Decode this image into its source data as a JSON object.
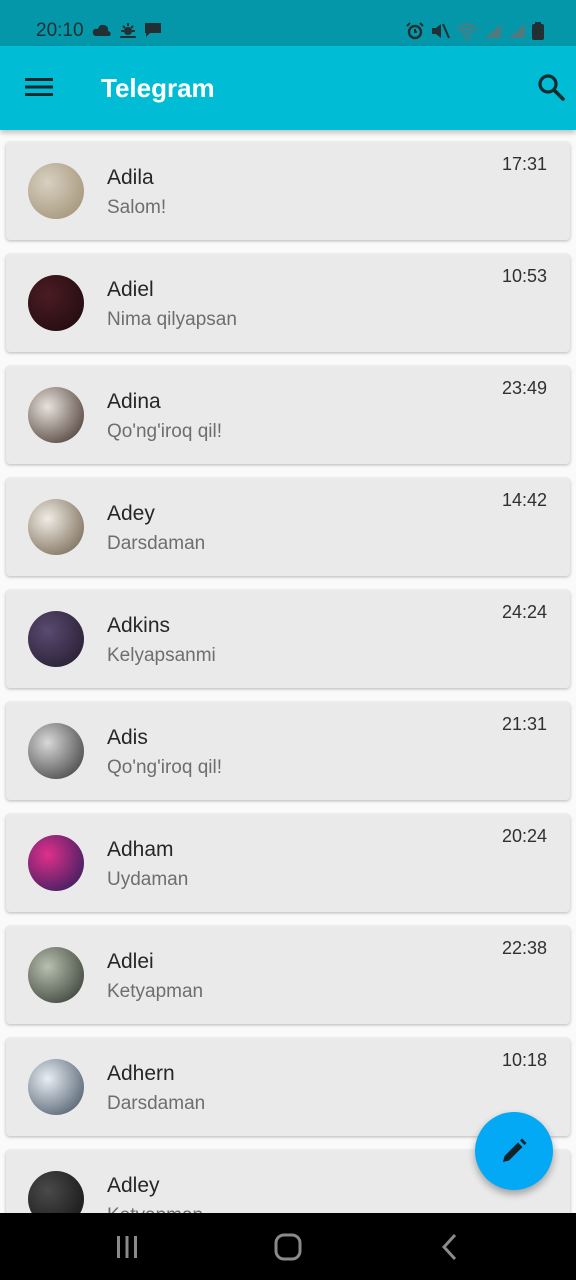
{
  "status_bar": {
    "time": "20:10",
    "left_icons": [
      "cloud-icon",
      "weather-icon",
      "message-icon"
    ],
    "right_icons": [
      "alarm-icon",
      "mute-icon",
      "wifi-icon",
      "signal-icon",
      "signal-icon",
      "battery-icon"
    ]
  },
  "app_bar": {
    "title": "Telegram",
    "menu_icon": "menu-icon",
    "search_icon": "search-icon",
    "color": "#00bcd4"
  },
  "chats": [
    {
      "name": "Adila",
      "message": "Salom!",
      "time": "17:31",
      "avatar_colors": [
        "#d8d0c0",
        "#9c8c70"
      ]
    },
    {
      "name": "Adiel",
      "message": "Nima qilyapsan",
      "time": "10:53",
      "avatar_colors": [
        "#4a1c22",
        "#1c0a0e"
      ]
    },
    {
      "name": "Adina",
      "message": "Qo'ng'iroq qil!",
      "time": "23:49",
      "avatar_colors": [
        "#e8e2dc",
        "#3a2a22"
      ]
    },
    {
      "name": "Adey",
      "message": "Darsdaman",
      "time": "14:42",
      "avatar_colors": [
        "#f0ece4",
        "#6a5a44"
      ]
    },
    {
      "name": "Adkins",
      "message": "Kelyapsanmi",
      "time": "24:24",
      "avatar_colors": [
        "#5a4a70",
        "#20182a"
      ]
    },
    {
      "name": "Adis",
      "message": "Qo'ng'iroq qil!",
      "time": "21:31",
      "avatar_colors": [
        "#d8d8d8",
        "#303030"
      ]
    },
    {
      "name": "Adham",
      "message": "Uydaman",
      "time": "20:24",
      "avatar_colors": [
        "#e0308a",
        "#201c5a"
      ]
    },
    {
      "name": "Adlei",
      "message": "Ketyapman",
      "time": "22:38",
      "avatar_colors": [
        "#b8c0b0",
        "#2a3028"
      ]
    },
    {
      "name": "Adhern",
      "message": "Darsdaman",
      "time": "10:18",
      "avatar_colors": [
        "#e8eef4",
        "#3a4a5a"
      ]
    },
    {
      "name": "Adley",
      "message": "Ketyapman",
      "time": "",
      "avatar_colors": [
        "#4a4a4a",
        "#101010"
      ]
    }
  ],
  "fab": {
    "icon": "pencil-icon",
    "color": "#03a9f4"
  },
  "nav_bar": {
    "buttons": [
      "recent-apps-icon",
      "home-icon",
      "back-icon"
    ]
  }
}
